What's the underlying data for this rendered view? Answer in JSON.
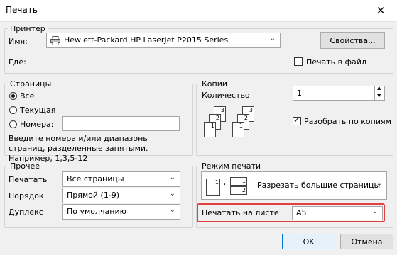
{
  "window": {
    "title": "Печать",
    "close_glyph": "✕"
  },
  "printer": {
    "legend": "Принтер",
    "name_label": "Имя:",
    "name_value": "Hewlett-Packard HP LaserJet P2015 Series",
    "properties_button": "Свойства...",
    "where_label": "Где:",
    "print_to_file_label": "Печать в файл",
    "print_to_file_checked": false
  },
  "pages": {
    "legend": "Страницы",
    "options": [
      {
        "label": "Все",
        "selected": true
      },
      {
        "label": "Текущая",
        "selected": false
      },
      {
        "label": "Номера:",
        "selected": false
      }
    ],
    "numbers_value": "",
    "hint": "Введите номера и/или диапазоны страниц, разделенные запятыми. Например, 1,3,5-12"
  },
  "copies": {
    "legend": "Копии",
    "count_label": "Количество",
    "count_value": "1",
    "collate_label": "Разобрать по копиям",
    "collate_checked": true,
    "page_numbers": [
      "1",
      "2",
      "3"
    ]
  },
  "other": {
    "legend": "Прочее",
    "print_label": "Печатать",
    "print_value": "Все страницы",
    "order_label": "Порядок",
    "order_value": "Прямой (1-9)",
    "duplex_label": "Дуплекс",
    "duplex_value": "По умолчанию"
  },
  "print_mode": {
    "legend": "Режим печати",
    "mode_value": "Разрезать большие страницы",
    "page_numbers": [
      "1",
      "2"
    ],
    "sheet_label": "Печатать на листе",
    "sheet_value": "A5",
    "highlight_color": "#e04040"
  },
  "footer": {
    "ok_button": "OK",
    "cancel_button": "Отмена"
  },
  "colors": {
    "accent": "#0078d7"
  }
}
